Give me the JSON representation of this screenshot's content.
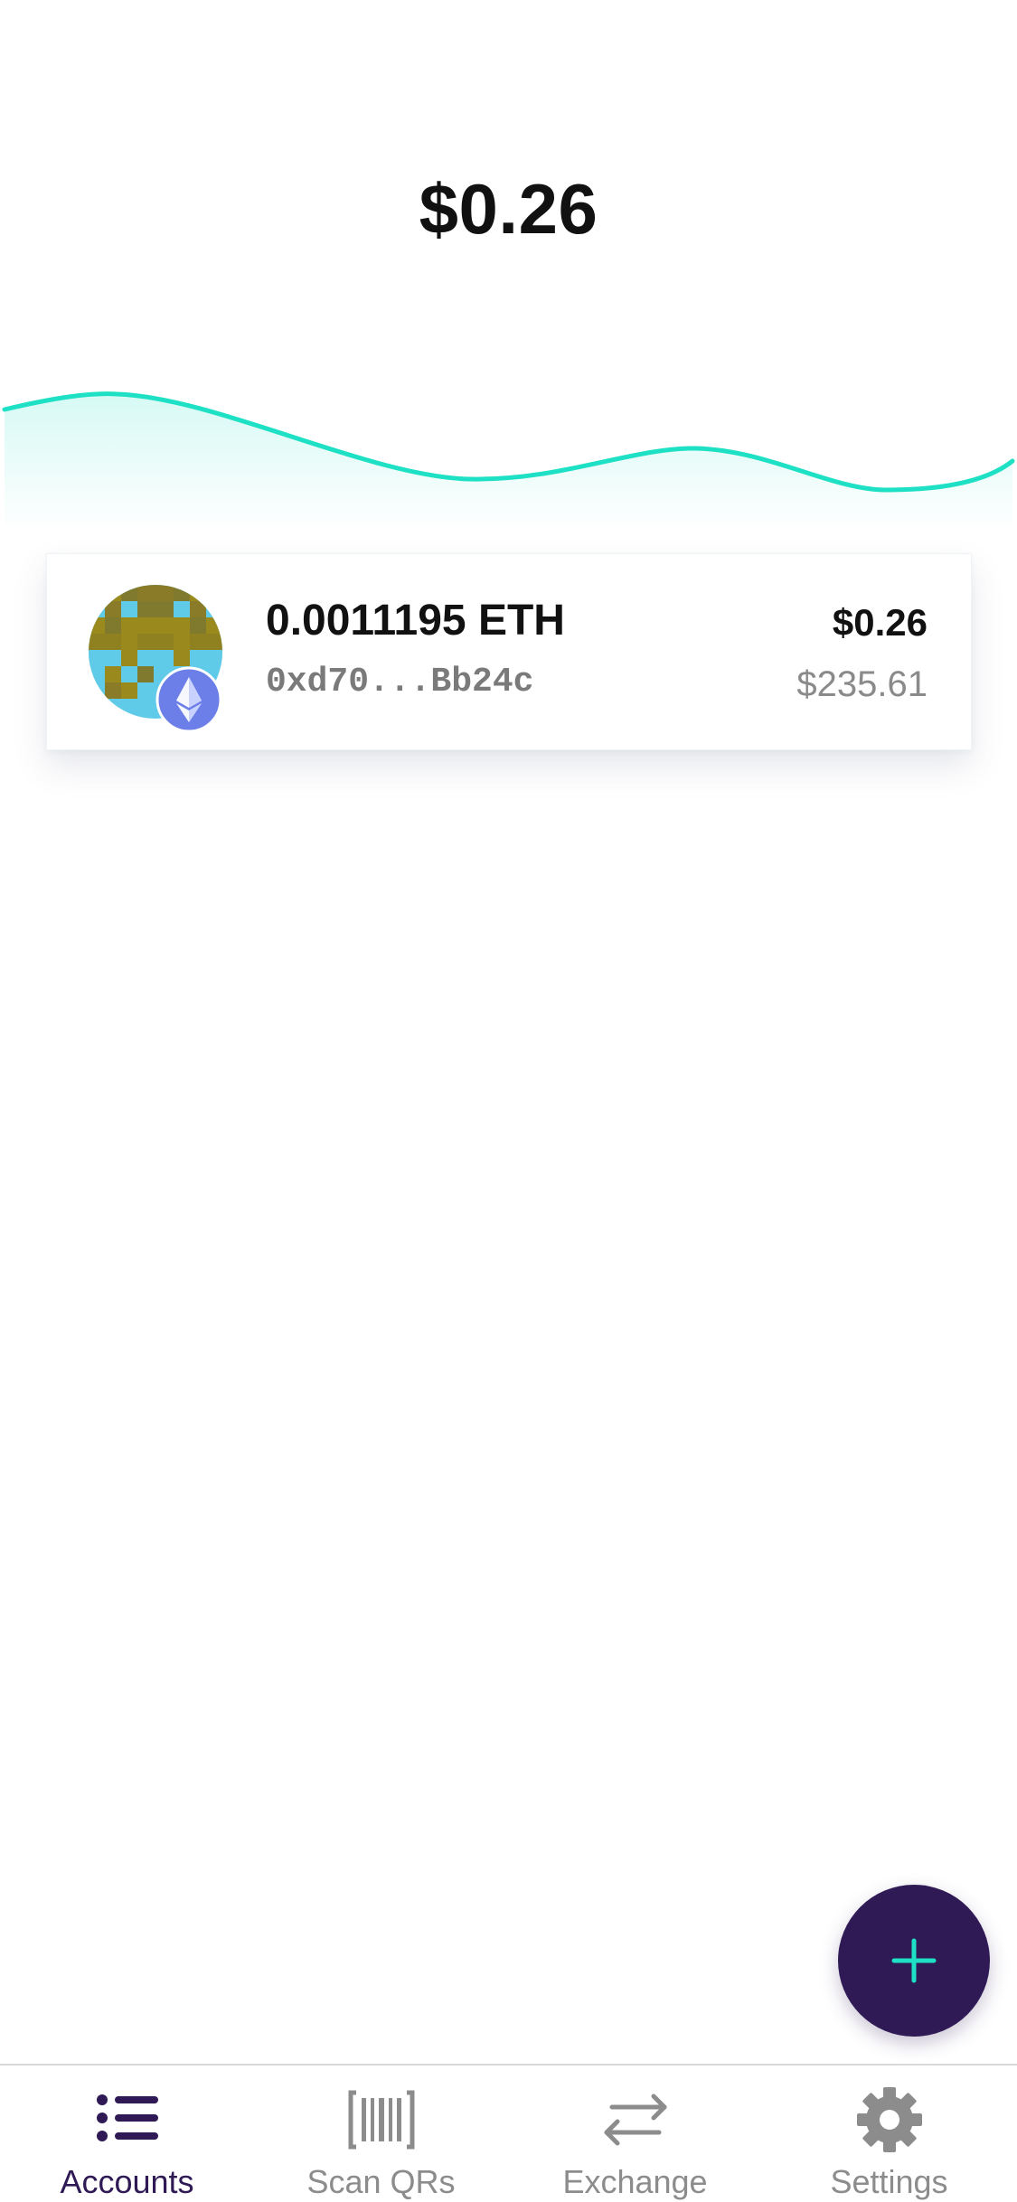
{
  "header": {
    "total_balance": "$0.26"
  },
  "colors": {
    "accent": "#1ee0c4",
    "primary": "#2f1a56",
    "inactive": "#8c8c8c",
    "eth_badge": "#6c7fe8"
  },
  "accounts": [
    {
      "amount": "0.0011195 ETH",
      "address": "0xd70...Bb24c",
      "fiat_value": "$0.26",
      "token_price": "$235.61",
      "avatar_icon": "identicon-avatar",
      "network_icon": "ethereum-icon"
    }
  ],
  "fab": {
    "icon": "plus-icon"
  },
  "tab_bar": {
    "tabs": [
      {
        "label": "Accounts",
        "icon": "list-icon",
        "active": true
      },
      {
        "label": "Scan QRs",
        "icon": "barcode-icon",
        "active": false
      },
      {
        "label": "Exchange",
        "icon": "exchange-arrows-icon",
        "active": false
      },
      {
        "label": "Settings",
        "icon": "gear-icon",
        "active": false
      }
    ]
  }
}
